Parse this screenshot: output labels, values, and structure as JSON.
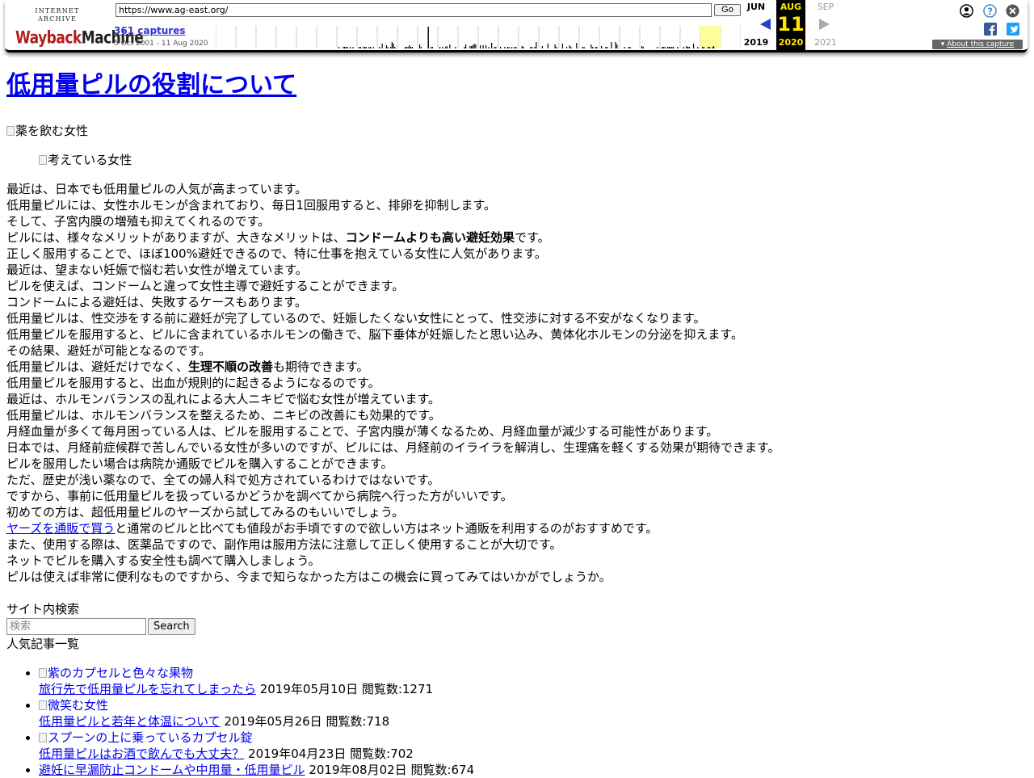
{
  "toolbar": {
    "logo_top": "INTERNET ARCHIVE",
    "logo_wayback": "Wayback",
    "logo_machine": "Machine",
    "url": "https://www.ag-east.org/",
    "go_label": "Go",
    "captures": "361 captures",
    "range": "5 Oct 2001 - 11 Aug 2020",
    "months": {
      "prev": {
        "name": "JUN",
        "year": "2019"
      },
      "current": {
        "name": "AUG",
        "day": "11",
        "year": "2020"
      },
      "next": {
        "name": "SEP",
        "year": "2021"
      }
    },
    "about_label": "About this capture",
    "icons": [
      "user-icon",
      "help-icon",
      "close-icon",
      "facebook-icon",
      "twitter-icon"
    ],
    "colors": {
      "accent_yellow": "#ffe800",
      "link_blue": "#3333cc",
      "highlight": "#ffff99"
    }
  },
  "page": {
    "title": "低用量ピルの役割について",
    "img1_alt": "薬を飲む女性",
    "img2_alt": "考えている女性",
    "article_lines": [
      [
        {
          "t": "最近は、日本でも低用量ピルの人気が高まっています。"
        }
      ],
      [
        {
          "t": "低用量ピルには、女性ホルモンが含まれており、毎日1回服用すると、排卵を抑制します。"
        }
      ],
      [
        {
          "t": "そして、子宮内膜の増殖も抑えてくれるのです。"
        }
      ],
      [
        {
          "t": "ピルには、様々なメリットがありますが、大きなメリットは、"
        },
        {
          "t": "コンドームよりも高い避妊効果",
          "b": true
        },
        {
          "t": "です。"
        }
      ],
      [
        {
          "t": "正しく服用することで、ほぼ100%避妊できるので、特に仕事を抱えている女性に人気があります。"
        }
      ],
      [
        {
          "t": "最近は、望まない妊娠で悩む若い女性が増えています。"
        }
      ],
      [
        {
          "t": "ピルを使えば、コンドームと違って女性主導で避妊することができます。"
        }
      ],
      [
        {
          "t": "コンドームによる避妊は、失敗するケースもあります。"
        }
      ],
      [
        {
          "t": "低用量ピルは、性交渉をする前に避妊が完了しているので、妊娠したくない女性にとって、性交渉に対する不安がなくなります。"
        }
      ],
      [
        {
          "t": "低用量ピルを服用すると、ピルに含まれているホルモンの働きで、脳下垂体が妊娠したと思い込み、黄体化ホルモンの分泌を抑えます。"
        }
      ],
      [
        {
          "t": "その結果、避妊が可能となるのです。"
        }
      ],
      [
        {
          "t": "低用量ピルは、避妊だけでなく、"
        },
        {
          "t": "生理不順の改善",
          "b": true
        },
        {
          "t": "も期待できます。"
        }
      ],
      [
        {
          "t": "低用量ピルを服用すると、出血が規則的に起きるようになるのです。"
        }
      ],
      [
        {
          "t": "最近は、ホルモンバランスの乱れによる大人ニキビで悩む女性が増えています。"
        }
      ],
      [
        {
          "t": "低用量ピルは、ホルモンバランスを整えるため、ニキビの改善にも効果的です。"
        }
      ],
      [
        {
          "t": "月経血量が多くて毎月困っている人は、ピルを服用することで、子宮内膜が薄くなるため、月経血量が減少する可能性があります。"
        }
      ],
      [
        {
          "t": "日本では、月経前症候群で苦しんでいる女性が多いのですが、ピルには、月経前のイライラを解消し、生理痛を軽くする効果が期待できます。"
        }
      ],
      [
        {
          "t": "ピルを服用したい場合は病院か通販でピルを購入することができます。"
        }
      ],
      [
        {
          "t": "ただ、歴史が浅い薬なので、全ての婦人科で処方されているわけではないです。"
        }
      ],
      [
        {
          "t": "ですから、事前に低用量ピルを扱っているかどうかを調べてから病院へ行った方がいいです。"
        }
      ],
      [
        {
          "t": "初めての方は、超低用量ピルのヤーズから試してみるのもいいでしょう。"
        }
      ],
      [
        {
          "t": "ヤーズを通販で買う",
          "link": true
        },
        {
          "t": "と通常のピルと比べても値段がお手頃ですので欲しい方はネット通販を利用するのがおすすめです。"
        }
      ],
      [
        {
          "t": "また、使用する際は、医薬品ですので、副作用は服用方法に注意して正しく使用することが大切です。"
        }
      ],
      [
        {
          "t": "ネットでピルを購入する安全性も調べて購入しましょう。"
        }
      ],
      [
        {
          "t": "ピルは使えば非常に便利なものですから、今まで知らなかった方はこの機会に買ってみてはいかがでしょうか。"
        }
      ]
    ],
    "search": {
      "heading": "サイト内検索",
      "placeholder": "検索",
      "button": "Search"
    },
    "popular": {
      "heading": "人気記事一覧",
      "items": [
        {
          "img_alt": "紫のカプセルと色々な果物",
          "title": "旅行先で低用量ピルを忘れてしまったら",
          "meta": " 2019年05月10日 閲覧数:1271"
        },
        {
          "img_alt": "微笑む女性",
          "title": "低用量ピルと若年と体温について",
          "meta": " 2019年05月26日 閲覧数:718"
        },
        {
          "img_alt": "スプーンの上に乗っているカプセル錠",
          "title": "低用量ピルはお酒で飲んでも大丈夫？",
          "meta": " 2019年04月23日 閲覧数:702"
        },
        {
          "img_alt": "",
          "title": "避妊に早漏防止コンドームや中用量・低用量ピル",
          "meta": " 2019年08月02日 閲覧数:674"
        }
      ]
    }
  }
}
